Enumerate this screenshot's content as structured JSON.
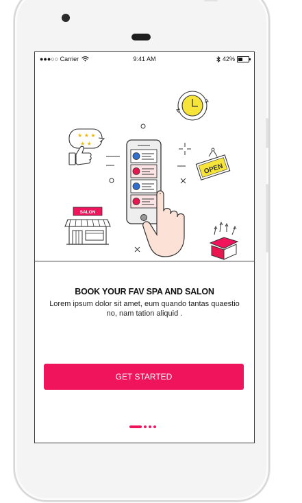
{
  "status_bar": {
    "carrier": "●●●○○ Carrier",
    "time": "9:41 AM",
    "battery": "42%"
  },
  "onboarding": {
    "sign_text": "SALON",
    "open_sign_text": "OPEN",
    "title": "BOOK YOUR FAV SPA AND SALON",
    "description": "Lorem ipsum dolor sit amet, eum quando tantas quaestio no, nam tation aliquid .",
    "cta_label": "GET STARTED",
    "page_count": 4,
    "active_page": 1
  },
  "colors": {
    "accent": "#f0145c",
    "blue": "#2f6fd0",
    "red": "#e8174f",
    "yellow": "#f6e43a",
    "pink_light": "#fde4e4"
  },
  "icons": [
    "wifi-icon",
    "bluetooth-icon",
    "battery-icon",
    "clock-icon",
    "rating-stars-icon",
    "thumbs-up-icon",
    "open-sign-icon",
    "salon-store-icon",
    "gift-box-icon",
    "hand-pointer-icon",
    "smartphone-icon"
  ]
}
